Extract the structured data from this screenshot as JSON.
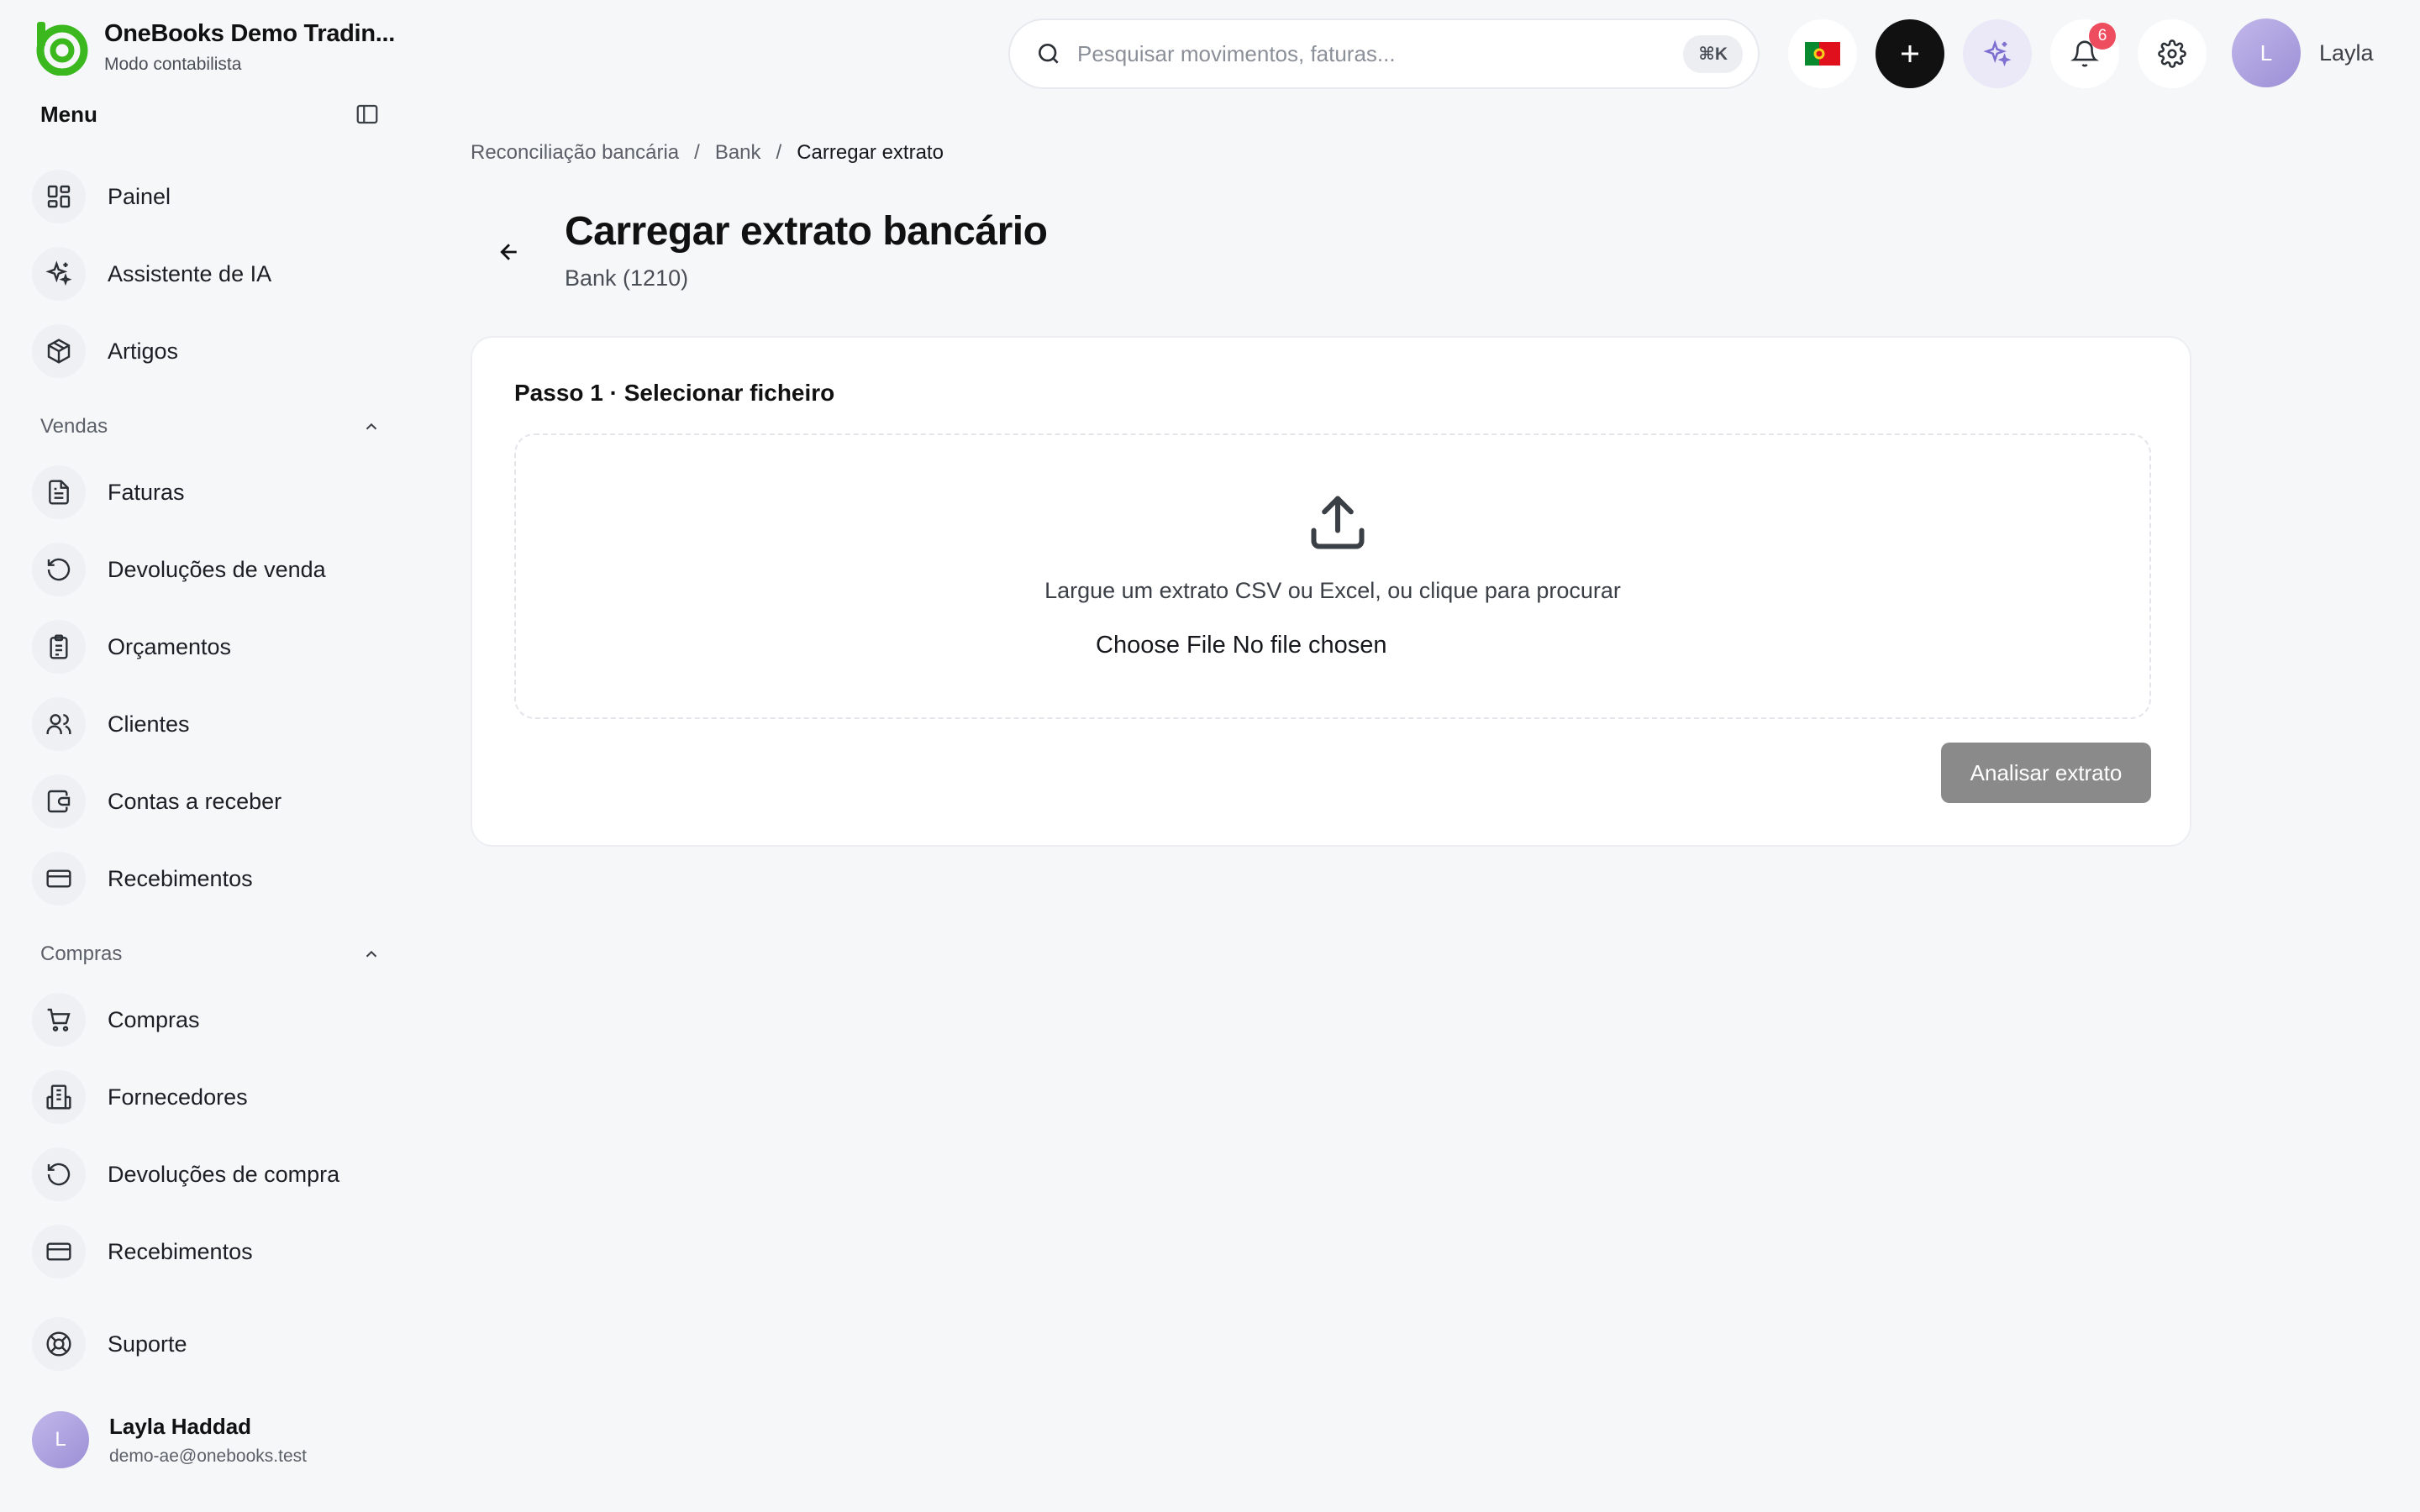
{
  "app": {
    "company_name": "OneBooks Demo Tradin...",
    "mode": "Modo contabilista"
  },
  "sidebar": {
    "menu_title": "Menu",
    "top_items": [
      {
        "label": "Painel",
        "icon": "dashboard-icon"
      },
      {
        "label": "Assistente de IA",
        "icon": "sparkles-icon"
      },
      {
        "label": "Artigos",
        "icon": "package-icon"
      }
    ],
    "sales": {
      "title": "Vendas",
      "items": [
        {
          "label": "Faturas",
          "icon": "invoice-icon"
        },
        {
          "label": "Devoluções de venda",
          "icon": "return-icon"
        },
        {
          "label": "Orçamentos",
          "icon": "clipboard-icon"
        },
        {
          "label": "Clientes",
          "icon": "users-icon"
        },
        {
          "label": "Contas a receber",
          "icon": "wallet-icon"
        },
        {
          "label": "Recebimentos",
          "icon": "card-icon"
        }
      ]
    },
    "purchases": {
      "title": "Compras",
      "items": [
        {
          "label": "Compras",
          "icon": "cart-icon"
        },
        {
          "label": "Fornecedores",
          "icon": "building-icon"
        },
        {
          "label": "Devoluções de compra",
          "icon": "return-icon"
        },
        {
          "label": "Recebimentos",
          "icon": "card-icon"
        }
      ]
    },
    "support": {
      "label": "Suporte",
      "icon": "lifebuoy-icon"
    },
    "user": {
      "initial": "L",
      "name": "Layla Haddad",
      "email": "demo-ae@onebooks.test"
    }
  },
  "topbar": {
    "search_placeholder": "Pesquisar movimentos, faturas...",
    "shortcut": "⌘K",
    "notifications_count": "6",
    "user_initial": "L",
    "user_name": "Layla"
  },
  "breadcrumb": {
    "items": [
      "Reconciliação bancária",
      "Bank"
    ],
    "current": "Carregar extrato",
    "separator": "/"
  },
  "page": {
    "title": "Carregar extrato bancário",
    "subtitle": "Bank (1210)"
  },
  "card": {
    "step_title": "Passo 1 · Selecionar ficheiro",
    "drop_text": "Largue um extrato CSV ou Excel, ou clique para procurar",
    "file_button": "Choose File",
    "file_status": "No file chosen",
    "analyze_label": "Analisar extrato"
  },
  "colors": {
    "brand_green": "#3cb81f",
    "notification_badge": "#ee4d5f",
    "primary_dark": "#111111",
    "disabled_button": "#8a8a8a"
  }
}
